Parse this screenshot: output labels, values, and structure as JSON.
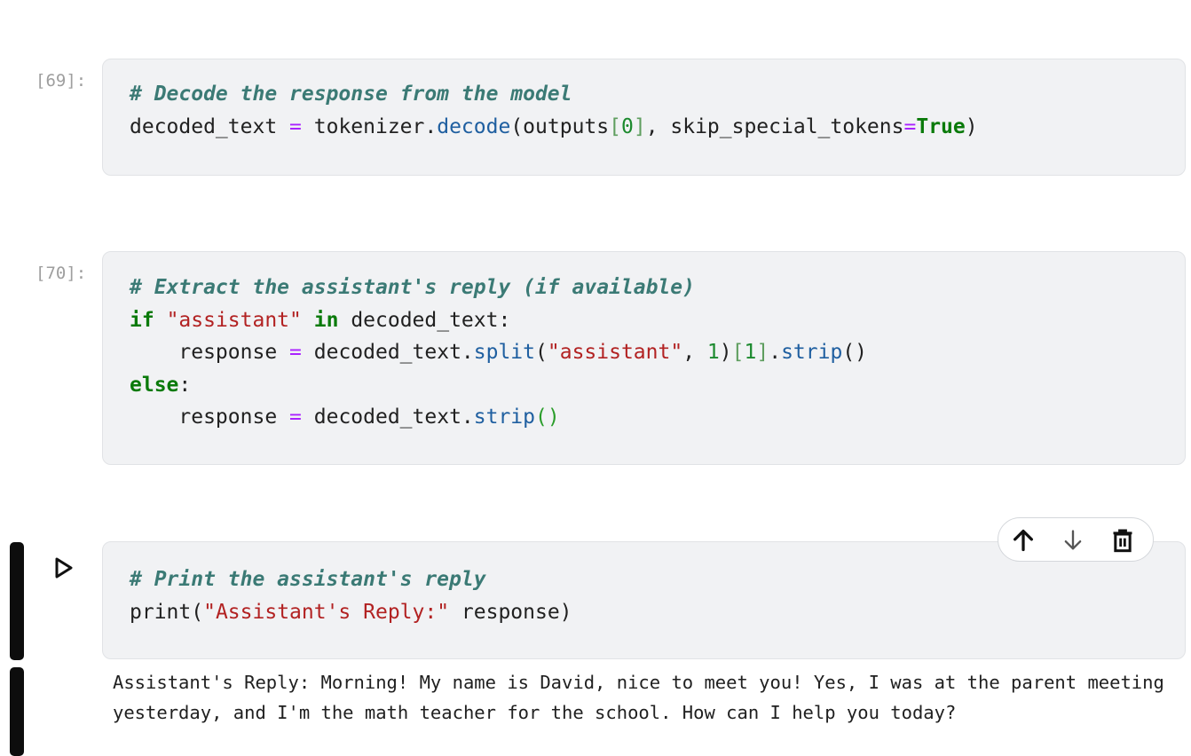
{
  "cells": [
    {
      "prompt": "[69]:",
      "comment": "# Decode the response from the model",
      "line2": {
        "var": "decoded_text",
        "eq": "=",
        "obj": "tokenizer.",
        "fn": "decode",
        "open": "(outputs",
        "lb": "[",
        "num": "0",
        "rb": "]",
        "mid": ", skip_special_tokens",
        "eq2": "=",
        "kw": "True",
        "close": ")"
      }
    },
    {
      "prompt": "[70]:",
      "comment": "# Extract the assistant's reply (if available)",
      "line2": {
        "kw_if": "if",
        "str": "\"assistant\"",
        "kw_in": "in",
        "rest": "decoded_text:"
      },
      "line3": {
        "var": "response",
        "eq": "=",
        "obj": "decoded_text.",
        "fn": "split",
        "open": "(",
        "str": "\"assistant\"",
        "sep": ", ",
        "num": "1",
        "close": ")",
        "lb": "[",
        "idx": "1",
        "rb": "]",
        "dot": ".",
        "fn2": "strip",
        "parens": "()"
      },
      "line4": {
        "kw": "else",
        "colon": ":"
      },
      "line5": {
        "var": "response",
        "eq": "=",
        "obj": "decoded_text.",
        "fn": "strip",
        "parens": "()"
      }
    },
    {
      "comment": "# Print the assistant's reply",
      "line2": {
        "fn": "print",
        "open": "(",
        "str": "\"Assistant's Reply:\"",
        "rest": " response)"
      }
    }
  ],
  "output_text": "Assistant's Reply: Morning! My name is David, nice to meet you! Yes, I was at the parent meeting yesterday, and I'm the math teacher for the school. How can I help you today?",
  "toolbar": {
    "icons": [
      "arrow-up-icon",
      "arrow-down-icon",
      "trash-icon"
    ]
  },
  "run_icon": "play-outline-icon"
}
